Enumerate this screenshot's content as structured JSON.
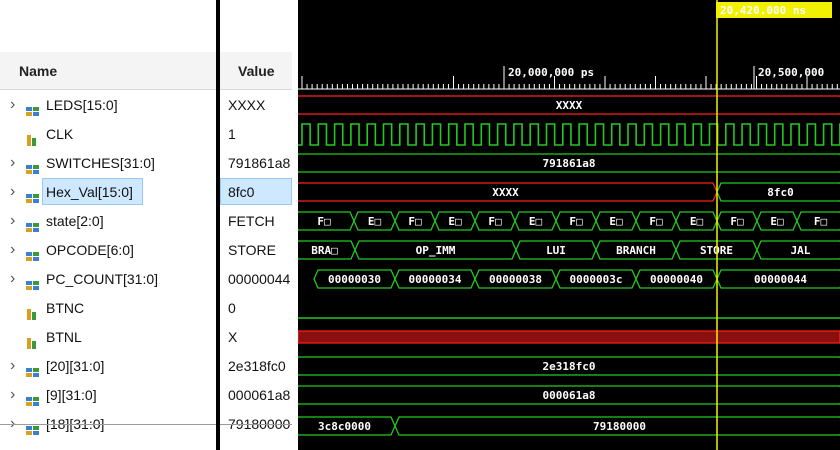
{
  "header": {
    "name_col": "Name",
    "value_col": "Value"
  },
  "cursor": {
    "time_label": "20,420.000 ns"
  },
  "ruler": {
    "labels": [
      "20,000,000 ps",
      "20,500,000"
    ]
  },
  "signals": [
    {
      "name": "LEDS[15:0]",
      "value": "XXXX",
      "expandable": true,
      "icon": "bus-icon"
    },
    {
      "name": "CLK",
      "value": "1",
      "expandable": false,
      "icon": "bit-icon"
    },
    {
      "name": "SWITCHES[31:0]",
      "value": "791861a8",
      "expandable": true,
      "icon": "bus-icon"
    },
    {
      "name": "Hex_Val[15:0]",
      "value": "8fc0",
      "expandable": true,
      "icon": "bus-icon",
      "selected": true
    },
    {
      "name": "state[2:0]",
      "value": "FETCH",
      "expandable": true,
      "icon": "bus-icon"
    },
    {
      "name": "OPCODE[6:0]",
      "value": "STORE",
      "expandable": true,
      "icon": "bus-icon"
    },
    {
      "name": "PC_COUNT[31:0]",
      "value": "00000044",
      "expandable": true,
      "icon": "bus-icon"
    },
    {
      "name": "BTNC",
      "value": "0",
      "expandable": false,
      "icon": "bit-icon"
    },
    {
      "name": "BTNL",
      "value": "X",
      "expandable": false,
      "icon": "bit-icon"
    },
    {
      "name": "[20][31:0]",
      "value": "2e318fc0",
      "expandable": true,
      "icon": "bus-icon"
    },
    {
      "name": "[9][31:0]",
      "value": "000061a8",
      "expandable": true,
      "icon": "bus-icon"
    },
    {
      "name": "[18][31:0]",
      "value": "79180000",
      "expandable": true,
      "icon": "bus-icon"
    }
  ],
  "waves": {
    "LEDS": [
      "XXXX"
    ],
    "SWITCHES": [
      "791861a8"
    ],
    "Hex_Val": [
      "XXXX",
      "8fc0"
    ],
    "state": [
      "F□",
      "E□",
      "F□",
      "E□",
      "F□",
      "E□",
      "F□",
      "E□",
      "F□",
      "E□",
      "F□",
      "E□",
      "F□"
    ],
    "OPCODE": [
      "BRA□",
      "OP_IMM",
      "LUI",
      "BRANCH",
      "STORE",
      "JAL"
    ],
    "PC_COUNT": [
      "00000030",
      "00000034",
      "00000038",
      "0000003c",
      "00000040",
      "00000044"
    ],
    "r20": [
      "2e318fc0"
    ],
    "r9": [
      "000061a8"
    ],
    "r18": [
      "3c8c0000",
      "79180000"
    ]
  },
  "colors": {
    "bus": "#22c922",
    "unknown": "#ff2020",
    "cursor": "#f2f200",
    "ruler": "#fff"
  }
}
